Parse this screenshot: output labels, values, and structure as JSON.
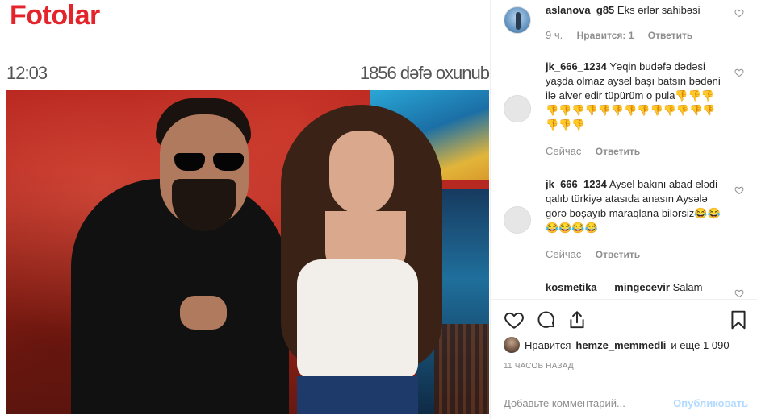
{
  "post_image": {
    "brand": "Fotolar",
    "time": "12:03",
    "reads": "1856 dəfə oxunub"
  },
  "comments": [
    {
      "username": "aslanova_g85",
      "text": "Eks ərlər sahibəsi",
      "time": "9 ч.",
      "likes": "Нравится: 1",
      "reply": "Ответить"
    },
    {
      "username": "jk_666_1234",
      "text": "Yəqin budəfə dədəsi yaşda olmaz aysel başı batsın bədəni ilə alver edir tüpürüm o pula👎👎👎👎👎👎👎👎👎👎👎👎👎👎👎👎👎👎👎",
      "time": "Сейчас",
      "reply": "Ответить"
    },
    {
      "username": "jk_666_1234",
      "text": "Aysel bakını abad elədi qalıb türkiyə atasıda anasın Aysələ görə boşayıb maraqlana bilərsiz😂😂😂😂😂😂",
      "time": "Сейчас",
      "reply": "Ответить"
    },
    {
      "username": "kosmetika___mingecevir",
      "text": "Salam"
    }
  ],
  "likes": {
    "prefix": "Нравится",
    "user": "hemze_memmedli",
    "suffix": "и ещё 1 090"
  },
  "time_ago": "11 ЧАСОВ НАЗАД",
  "add_comment": {
    "placeholder": "Добавьте комментарий...",
    "publish": "Опубликовать"
  },
  "icons": {
    "like": "heart-icon",
    "comment": "comment-bubble-icon",
    "share": "share-icon",
    "save": "bookmark-icon"
  },
  "colors": {
    "brand_red": "#e4232b",
    "publish_disabled": "#b3dbff",
    "meta_gray": "#8e8e8e"
  }
}
